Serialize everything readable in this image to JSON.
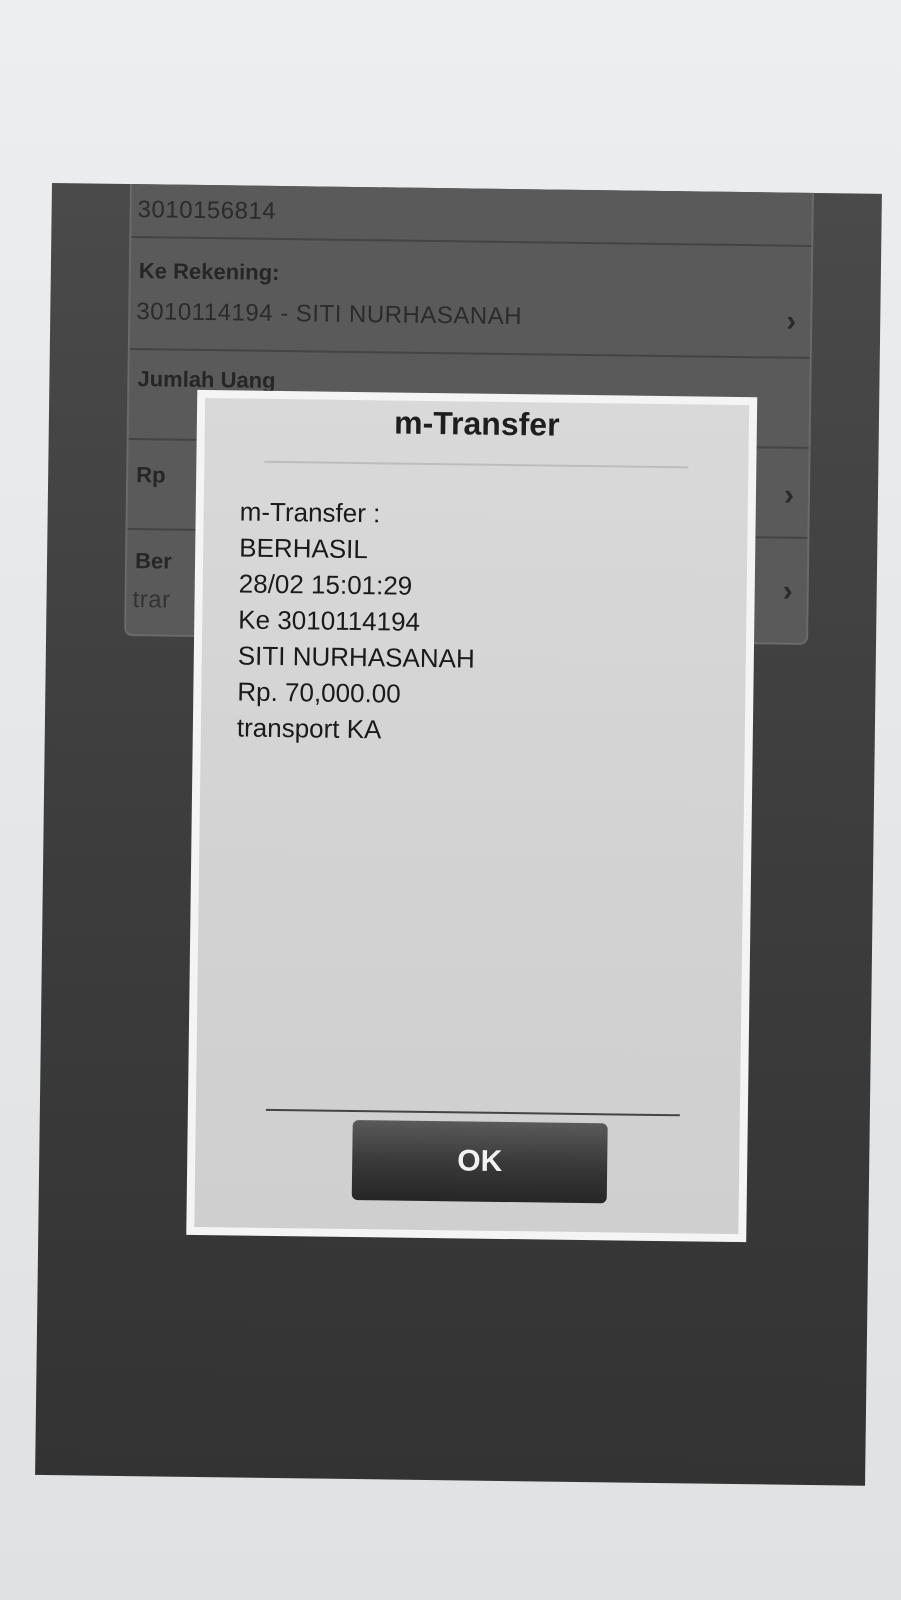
{
  "background_form": {
    "from_account": "3010156814",
    "to_account_label": "Ke Rekening:",
    "to_account_value": "3010114194 - SITI NURHASANAH",
    "amount_label": "Jumlah Uang",
    "amount_value": "Rp",
    "note_label": "Ber",
    "note_value": "trar"
  },
  "dialog": {
    "title": "m-Transfer",
    "lines": [
      "m-Transfer :",
      "BERHASIL",
      "28/02 15:01:29",
      "Ke 3010114194",
      "SITI NURHASANAH",
      "Rp. 70,000.00",
      "transport KA"
    ],
    "ok_label": "OK"
  },
  "colors": {
    "paper": "#e6e8ea",
    "printout": "#3d3d3d",
    "dialog_bg": "#d6d6d6",
    "button": "#333333"
  },
  "icons": {
    "row_chevron": "chevron-right-icon"
  }
}
